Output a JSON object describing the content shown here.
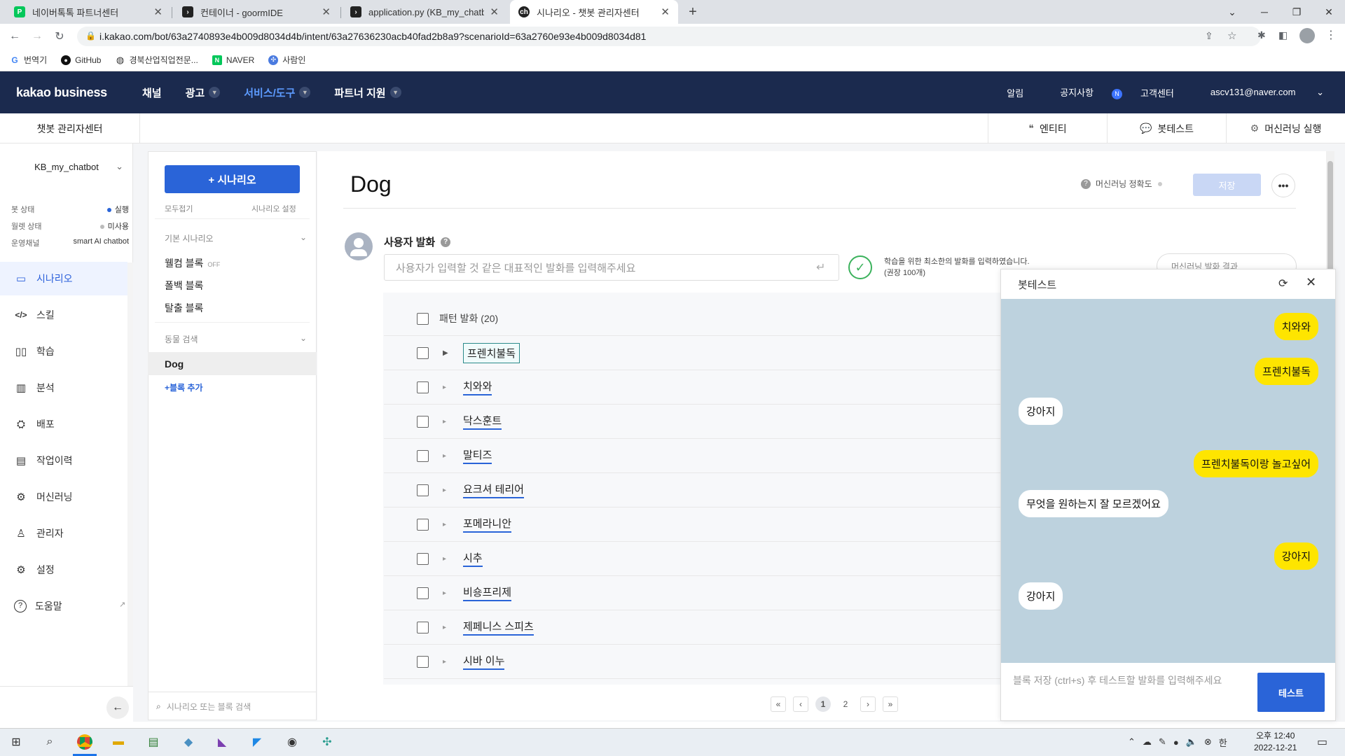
{
  "browser": {
    "tabs": [
      {
        "title": "네이버톡톡 파트너센터",
        "icon": "naver-talk-icon",
        "color": "#03c75a"
      },
      {
        "title": "컨테이너 - goormIDE",
        "icon": "terminal-icon",
        "color": "#222222"
      },
      {
        "title": "application.py (KB_my_chatbot_",
        "icon": "terminal-icon",
        "color": "#222222"
      },
      {
        "title": "시나리오 - 챗봇 관리자센터",
        "icon": "kakao-icon",
        "color": "#222222"
      }
    ],
    "url": "i.kakao.com/bot/63a2740893e4b009d8034d4b/intent/63a27636230acb40fad2b8a9?scenarioId=63a2760e93e4b009d8034d81",
    "bookmarks": [
      {
        "label": "번역기",
        "icon": "google-icon"
      },
      {
        "label": "GitHub",
        "icon": "github-icon"
      },
      {
        "label": "경북산업직업전문...",
        "icon": "globe-icon"
      },
      {
        "label": "NAVER",
        "icon": "naver-icon"
      },
      {
        "label": "사람인",
        "icon": "saramin-icon"
      }
    ]
  },
  "header": {
    "logo": "kakao business",
    "menu": [
      {
        "label": "채널",
        "active": false,
        "has_dropdown": false
      },
      {
        "label": "광고",
        "active": false,
        "has_dropdown": true
      },
      {
        "label": "서비스/도구",
        "active": true,
        "has_dropdown": true
      },
      {
        "label": "파트너 지원",
        "active": false,
        "has_dropdown": true
      }
    ],
    "alarm": "알림",
    "notice": "공지사항",
    "notice_badge": "N",
    "support": "고객센터",
    "account": "ascv131@naver.com"
  },
  "subheader": {
    "title": "챗봇 관리자센터",
    "entity": "엔티티",
    "bottest": "봇테스트",
    "ml_run": "머신러닝 실행"
  },
  "sidebar": {
    "bot_name": "KB_my_chatbot",
    "status": [
      {
        "label": "봇 상태",
        "value": "실행",
        "dot": "#2a64d8"
      },
      {
        "label": "월렛 상태",
        "value": "미사용",
        "dot": "#bbbbbb"
      },
      {
        "label": "운영채널",
        "value": "smart AI chatbot",
        "dot": ""
      }
    ],
    "items": [
      {
        "label": "시나리오",
        "icon": "scenario-icon",
        "glyph": "▭",
        "active": true
      },
      {
        "label": "스킬",
        "icon": "code-icon",
        "glyph": "</>",
        "active": false
      },
      {
        "label": "학습",
        "icon": "book-icon",
        "glyph": "📖",
        "active": false
      },
      {
        "label": "분석",
        "icon": "chart-icon",
        "glyph": "▥",
        "active": false
      },
      {
        "label": "배포",
        "icon": "deploy-icon",
        "glyph": "⛭",
        "active": false
      },
      {
        "label": "작업이력",
        "icon": "history-icon",
        "glyph": "▤",
        "active": false
      },
      {
        "label": "머신러닝",
        "icon": "chip-icon",
        "glyph": "⚙",
        "active": false
      },
      {
        "label": "관리자",
        "icon": "user-icon",
        "glyph": "👤",
        "active": false
      },
      {
        "label": "설정",
        "icon": "settings-icon",
        "glyph": "⚙",
        "active": false
      },
      {
        "label": "도움말",
        "icon": "help-icon",
        "glyph": "?",
        "active": false
      }
    ]
  },
  "scenarios": {
    "add_button": "+ 시나리오",
    "collapse_all": "모두접기",
    "scenario_settings": "시나리오 설정",
    "group_basic": "기본 시나리오",
    "basic_items": [
      {
        "label": "웰컴 블록",
        "badge": "OFF"
      },
      {
        "label": "폴백 블록",
        "badge": ""
      },
      {
        "label": "탈출 블록",
        "badge": ""
      }
    ],
    "group_animal": "동물 검색",
    "selected": "Dog",
    "add_block": "+블록 추가",
    "search_placeholder": "시나리오 또는 블록 검색"
  },
  "block": {
    "title": "Dog",
    "ml_accuracy": "머신러닝 정확도",
    "save": "저장",
    "utterance_title": "사용자 발화",
    "utterance_placeholder": "사용자가 입력할 것 같은 대표적인 발화를 입력해주세요",
    "min_note_line1": "학습을 위한 최소한의 발화를 입력하였습니다.",
    "min_note_line2": "(권장 100개)",
    "ml_result": "머신러닝 발화 결과",
    "pattern_header": "패턴 발화 (20)",
    "utterances": [
      "프렌치불독",
      "치와와",
      "닥스훈트",
      "말티즈",
      "요크셔 테리어",
      "포메라니안",
      "시추",
      "비숑프리제",
      "제페니스 스피츠",
      "시바 이누"
    ],
    "pages": [
      "1",
      "2"
    ],
    "current_page": "1"
  },
  "bottest": {
    "title": "봇테스트",
    "messages": [
      {
        "from": "me",
        "text": "치와와"
      },
      {
        "from": "me",
        "text": "프렌치불독"
      },
      {
        "from": "bot",
        "text": "강아지"
      },
      {
        "from": "me",
        "text": "프렌치불독이랑 놀고싶어"
      },
      {
        "from": "bot",
        "text": "무엇을 원하는지 잘 모르겠어요"
      },
      {
        "from": "me",
        "text": "강아지"
      },
      {
        "from": "bot",
        "text": "강아지"
      }
    ],
    "input_placeholder": "블록 저장 (ctrl+s) 후 테스트할 발화를 입력해주세요",
    "test_button": "테스트"
  },
  "taskbar": {
    "time": "오후 12:40",
    "date": "2022-12-21",
    "ime": "한"
  }
}
